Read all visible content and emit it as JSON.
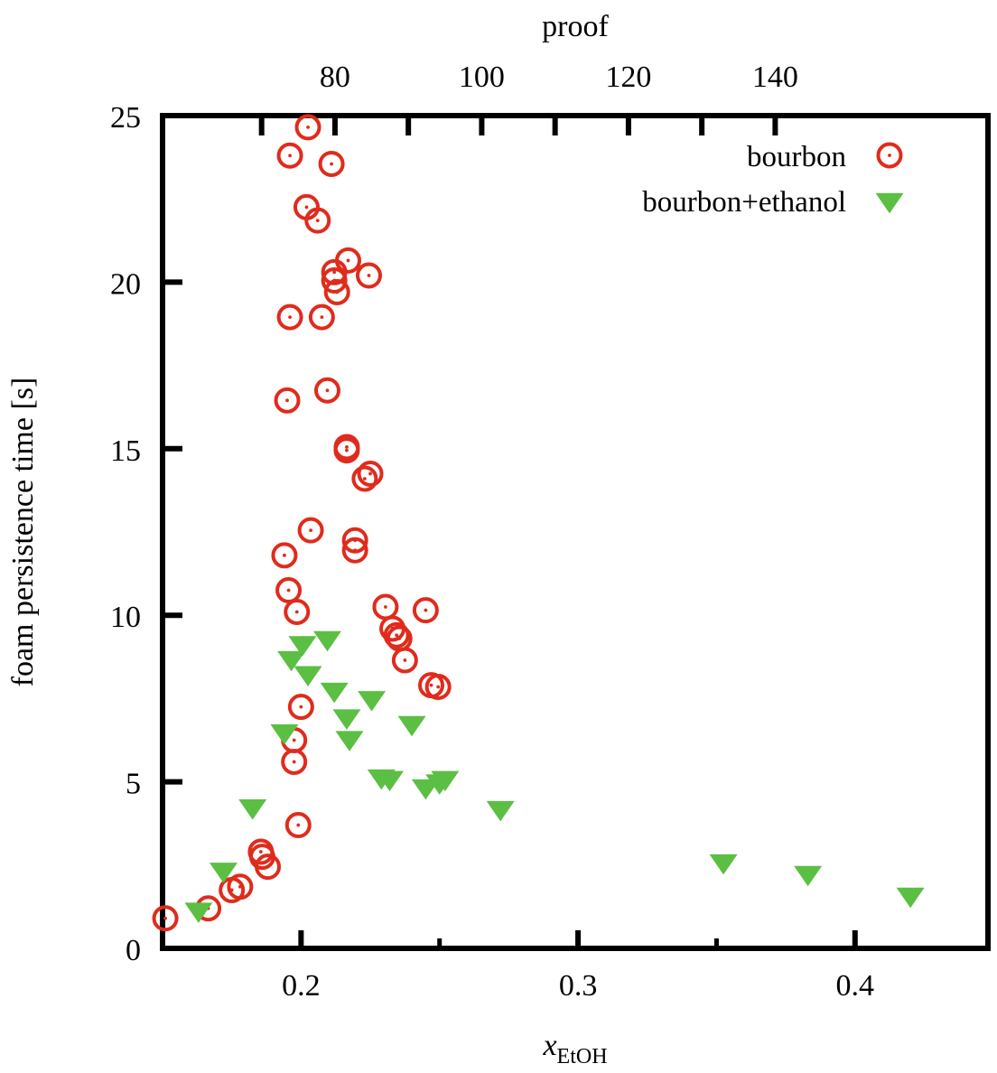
{
  "figure": {
    "background_color": "#ffffff",
    "frame_color": "#000000",
    "bourbon_color": "#E02B1C",
    "ethanol_color": "#5BBF43"
  },
  "axes": {
    "bottom": {
      "title_main": "x",
      "title_sub": "EtOH",
      "tick_labels": [
        "0.2",
        "0.3",
        "0.4"
      ],
      "tick_values": [
        0.2,
        0.3,
        0.4
      ],
      "minor_tick_values": [
        0.25,
        0.35
      ],
      "range": [
        0.15,
        0.448
      ]
    },
    "top": {
      "title": "proof",
      "tick_labels": [
        "80",
        "100",
        "120",
        "140"
      ],
      "tick_values": [
        80,
        100,
        120,
        140
      ],
      "minor_tick_values": [
        70,
        90,
        110,
        130
      ],
      "range": [
        56.5,
        169.0
      ]
    },
    "left": {
      "title": "foam persistence time [s]",
      "tick_labels": [
        "0",
        "5",
        "10",
        "15",
        "20",
        "25"
      ],
      "tick_values": [
        0,
        5,
        10,
        15,
        20,
        25
      ],
      "range": [
        0,
        25
      ]
    }
  },
  "legend": {
    "entries": [
      {
        "label": "bourbon",
        "marker": "open-circle-dot",
        "color": "#E02B1C"
      },
      {
        "label": "bourbon+ethanol",
        "marker": "filled-down-triangle",
        "color": "#5BBF43"
      }
    ]
  },
  "chart_data": {
    "type": "scatter",
    "title": "",
    "xlabel": "xEtOH",
    "ylabel": "foam persistence time [s]",
    "xlabel_top": "proof",
    "xlim": [
      0.15,
      0.448
    ],
    "ylim": [
      0,
      25
    ],
    "xticks": [
      0.2,
      0.3,
      0.4
    ],
    "yticks": [
      0,
      5,
      10,
      15,
      20,
      25
    ],
    "xticks_top": [
      80,
      100,
      120,
      140
    ],
    "grid": false,
    "legend_position": "top-right",
    "series": [
      {
        "name": "bourbon",
        "marker": "open-circle-dot",
        "color": "#E02B1C",
        "points": [
          [
            0.151,
            0.9
          ],
          [
            0.1665,
            1.2
          ],
          [
            0.175,
            1.75
          ],
          [
            0.178,
            1.85
          ],
          [
            0.1855,
            2.9
          ],
          [
            0.186,
            2.75
          ],
          [
            0.188,
            2.45
          ],
          [
            0.199,
            3.7
          ],
          [
            0.1975,
            5.6
          ],
          [
            0.1975,
            6.25
          ],
          [
            0.2,
            7.25
          ],
          [
            0.1985,
            10.1
          ],
          [
            0.1955,
            10.75
          ],
          [
            0.194,
            11.8
          ],
          [
            0.2035,
            12.55
          ],
          [
            0.195,
            16.45
          ],
          [
            0.2095,
            16.75
          ],
          [
            0.196,
            18.95
          ],
          [
            0.2075,
            18.95
          ],
          [
            0.213,
            19.7
          ],
          [
            0.212,
            20.05
          ],
          [
            0.212,
            20.3
          ],
          [
            0.217,
            20.65
          ],
          [
            0.2245,
            20.2
          ],
          [
            0.202,
            22.25
          ],
          [
            0.206,
            21.85
          ],
          [
            0.196,
            23.8
          ],
          [
            0.211,
            23.55
          ],
          [
            0.2025,
            24.65
          ],
          [
            0.2165,
            14.95
          ],
          [
            0.2165,
            15.05
          ],
          [
            0.225,
            14.25
          ],
          [
            0.223,
            14.1
          ],
          [
            0.2195,
            12.25
          ],
          [
            0.2195,
            11.95
          ],
          [
            0.2305,
            10.25
          ],
          [
            0.245,
            10.15
          ],
          [
            0.233,
            9.6
          ],
          [
            0.2345,
            9.4
          ],
          [
            0.2355,
            9.3
          ],
          [
            0.2375,
            8.65
          ],
          [
            0.247,
            7.9
          ],
          [
            0.2495,
            7.85
          ]
        ]
      },
      {
        "name": "bourbon+ethanol",
        "marker": "filled-down-triangle",
        "color": "#5BBF43",
        "points": [
          [
            0.163,
            1.15
          ],
          [
            0.172,
            2.35
          ],
          [
            0.1825,
            4.25
          ],
          [
            0.194,
            6.5
          ],
          [
            0.1965,
            8.7
          ],
          [
            0.2025,
            8.25
          ],
          [
            0.2005,
            9.15
          ],
          [
            0.2095,
            9.3
          ],
          [
            0.212,
            7.75
          ],
          [
            0.2165,
            6.95
          ],
          [
            0.2175,
            6.3
          ],
          [
            0.2255,
            7.5
          ],
          [
            0.229,
            5.15
          ],
          [
            0.232,
            5.1
          ],
          [
            0.24,
            6.75
          ],
          [
            0.245,
            4.85
          ],
          [
            0.25,
            5.0
          ],
          [
            0.252,
            5.1
          ],
          [
            0.272,
            4.2
          ],
          [
            0.3525,
            2.6
          ],
          [
            0.383,
            2.25
          ],
          [
            0.42,
            1.6
          ]
        ]
      }
    ]
  }
}
